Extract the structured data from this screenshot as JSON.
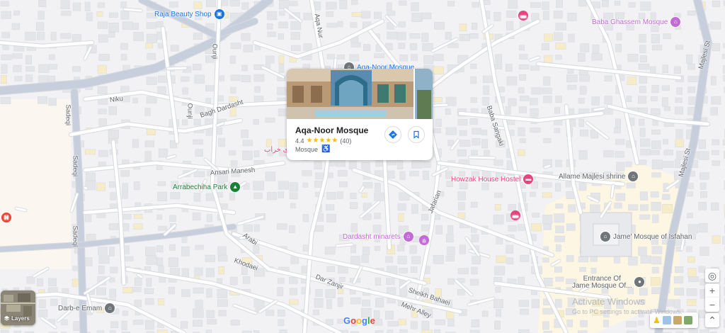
{
  "pois": [
    {
      "name": "raja-beauty-shop",
      "label": "Raja Beauty Shop",
      "color": "#1a73e8",
      "icon": "shopping-bag-icon",
      "glyph": "▣"
    },
    {
      "name": "aqa-noor-mosque",
      "label": "Aqa-Noor Mosque",
      "color": "#1a73e8",
      "icon": "mosque-icon",
      "glyph": "⌂"
    },
    {
      "name": "baba-ghassem-mosque",
      "label": "Baba Ghassem Mosque",
      "color": "#c26ad6",
      "icon": "mosque-icon",
      "glyph": "⌂"
    },
    {
      "name": "arrabechiha-park",
      "label": "Arrabechiha Park",
      "color": "#188038",
      "icon": "tree-icon",
      "glyph": "▲"
    },
    {
      "name": "howzak-house-hostel",
      "label": "Howzak House Hostel",
      "color": "#e8447e",
      "icon": "bed-icon",
      "glyph": "▬"
    },
    {
      "name": "allame-majlesi-shrine",
      "label": "Allame Majlesi shrine",
      "color": "#70757a",
      "icon": "mosque-icon",
      "glyph": "⌂"
    },
    {
      "name": "dardasht-minarets",
      "label": "Dardasht minarets",
      "color": "#c26ad6",
      "icon": "landmark-icon",
      "glyph": "⌂"
    },
    {
      "name": "jame-mosque",
      "label": "Jame' Mosque of Isfahan",
      "color": "#70757a",
      "icon": "mosque-icon",
      "glyph": "⌂"
    },
    {
      "name": "entrance-jame-mosque",
      "label": "Entrance Of\nJame Mosque Of...",
      "color": "#70757a",
      "icon": "place-icon",
      "glyph": "●"
    },
    {
      "name": "darb-e-emam",
      "label": "Darb-e Emam",
      "color": "#70757a",
      "icon": "mosque-icon",
      "glyph": "⌂"
    },
    {
      "name": "persian-label",
      "label": "داری خراب",
      "color": "#e8447e",
      "icon": "",
      "glyph": ""
    }
  ],
  "streets": [
    {
      "name": "street-niku",
      "label": "Niku"
    },
    {
      "name": "street-bagh-dardasht",
      "label": "Bagh Dardasht"
    },
    {
      "name": "street-ansari-manesh",
      "label": "Ansari Manesh"
    },
    {
      "name": "street-sadeqi",
      "label": "Sadeqi"
    },
    {
      "name": "street-sadeqi-2",
      "label": "Sadeqi"
    },
    {
      "name": "street-ounji",
      "label": "Ounji"
    },
    {
      "name": "street-ounji-2",
      "label": "Ounji"
    },
    {
      "name": "street-aqa-nur",
      "label": "Aqa Nur"
    },
    {
      "name": "street-baba-sangaki",
      "label": "Baba Sangaki"
    },
    {
      "name": "street-majlesi",
      "label": "Majlesi St"
    },
    {
      "name": "street-majlesi-2",
      "label": "Majlesi St"
    },
    {
      "name": "street-arabi",
      "label": "Arabi"
    },
    {
      "name": "street-khodaei",
      "label": "Khodaei"
    },
    {
      "name": "street-dar-zanjir",
      "label": "Dar Zanjir"
    },
    {
      "name": "street-sheikh-bahaei",
      "label": "Sheikh Bahaei"
    },
    {
      "name": "street-mehr-alley",
      "label": "Mehr Alley"
    },
    {
      "name": "street-jafarian",
      "label": "Jafarian"
    }
  ],
  "card": {
    "title": "Aqa-Noor Mosque",
    "rating": "4.4",
    "stars": "★★★★★",
    "reviews": "(40)",
    "category": "Mosque",
    "accessibility_icon": "♿"
  },
  "controls": {
    "layers_label": "Layers",
    "zoom_in": "+",
    "zoom_out": "−",
    "my_location": "◎",
    "expand": "⌃"
  },
  "watermark": {
    "line1": "Activate Windows",
    "line2": "Go to PC settings to activate Windows."
  },
  "logo": {
    "letters": [
      "G",
      "o",
      "o",
      "g",
      "l",
      "e"
    ],
    "colors": [
      "#4285f4",
      "#ea4335",
      "#fbbc05",
      "#4285f4",
      "#34a853",
      "#ea4335"
    ]
  },
  "colors": {
    "road": "#ffffff",
    "road_edge": "#d7dae0",
    "arterial": "#c7cfdc",
    "building": "#e4e5e8",
    "block_beige": "#fdf6e3"
  }
}
